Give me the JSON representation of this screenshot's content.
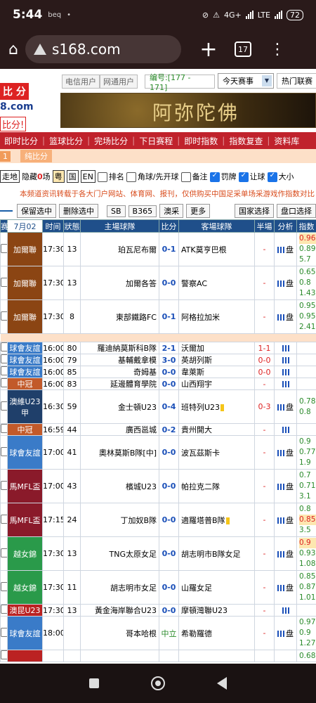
{
  "status": {
    "time": "5:44",
    "carrier_mark": "beq",
    "battery": "72",
    "net": "4G+",
    "lte": "LTE"
  },
  "browser": {
    "url": "s168.com",
    "tabs_count": "17"
  },
  "header": {
    "logo_top": "比 分",
    "logo_mid": "8.com",
    "logo_bot": "比分!",
    "telecom": "电信用户",
    "netcom": "网通用户",
    "account": "编号:[177 - 171]",
    "filter_select": "今天赛事",
    "hot_leagues": "热门联赛",
    "banner_text": "阿弥陀佛"
  },
  "nav": [
    "即时比分",
    "篮球比分",
    "完场比分",
    "下日赛程",
    "即时指数",
    "指数复查",
    "资料库"
  ],
  "subnav": {
    "tab1": "1",
    "tab2": "纯比分"
  },
  "options": {
    "walk": "走地",
    "hidden_prefix": "隐藏",
    "hidden_count": "0",
    "hidden_suffix": "场",
    "lang_yue": "粤",
    "lang_guo": "国",
    "lang_en": "EN",
    "rank": "排名",
    "corner": "角球/先开球",
    "note": "备注",
    "card": "罚牌",
    "handicap": "让球",
    "overunder": "大小"
  },
  "notice": "本频道资讯转载于各大门户网站、体育网、报刊，仅供购买中国足采单场采游戏作指数对比",
  "toolbar": {
    "keep": "保留选中",
    "delete": "删除选中",
    "sb": "SB",
    "b365": "B365",
    "macau": "澳采",
    "more": "更多",
    "country": "国家选择",
    "handicap_select": "盘口选择"
  },
  "table_headers": {
    "c0": "赛",
    "date": "7月02",
    "time": "时间",
    "state": "狀態",
    "home": "主場球隊",
    "score": "比分",
    "away": "客場球隊",
    "half": "半場",
    "analysis": "分析",
    "index": "指数"
  },
  "analysis_label": "盘",
  "rows": [
    {
      "league": "加爾聯",
      "color": "#8b4513",
      "time": "17:30",
      "state": "13",
      "home": "珀瓦尼布爾",
      "score": "0-1",
      "away": "ATK莫亨巴根",
      "half": "-",
      "idx": [
        "0.96",
        "0.89",
        "5.7"
      ],
      "hl": 0,
      "tall": true
    },
    {
      "league": "加爾聯",
      "color": "#8b4513",
      "time": "17:30",
      "state": "13",
      "home": "加爾各答",
      "score": "0-0",
      "away": "警察AC",
      "half": "-",
      "idx": [
        "0.65",
        "0.8",
        "1.43"
      ],
      "hl": -1,
      "tall": true
    },
    {
      "league": "加爾聯",
      "color": "#8b4513",
      "time": "17:30",
      "state": "8",
      "home": "東部鐵路FC",
      "score": "0-1",
      "away": "阿格拉加米",
      "half": "-",
      "idx": [
        "0.95",
        "0.95",
        "2.41"
      ],
      "hl": -2,
      "tall": true
    },
    {
      "league": "球會友誼",
      "color": "#3a7bc8",
      "time": "16:00",
      "state": "80",
      "home": "羅迪納莫斯科B隊",
      "score": "2-1",
      "away": "沃爾加",
      "half": "1-1",
      "idx": [],
      "hl": -1,
      "tall": false
    },
    {
      "league": "球會友誼",
      "color": "#3a7bc8",
      "time": "16:00",
      "state": "79",
      "home": "基輔戴拿模",
      "score": "3-0",
      "away": "英胡列斯",
      "half": "0-0",
      "idx": [],
      "hl": -1,
      "tall": false
    },
    {
      "league": "球會友誼",
      "color": "#3a7bc8",
      "time": "16:00",
      "state": "85",
      "home": "奇姆基",
      "score": "0-0",
      "away": "韋萊斯",
      "half": "0-0",
      "idx": [],
      "hl": -1,
      "tall": false
    },
    {
      "league": "中冠",
      "color": "#c25a2a",
      "time": "16:00",
      "state": "83",
      "home": "延邊體育學院",
      "score": "0-0",
      "away": "山西翔宇",
      "half": "-",
      "idx": [],
      "hl": -1,
      "tall": false
    },
    {
      "league": "澳維U23甲",
      "color": "#1f3f6a",
      "time": "16:30",
      "state": "59",
      "home": "金士頓U23",
      "score": "0-4",
      "away": "班特列U23",
      "half": "0-3",
      "idx": [
        "0.78",
        "0.8"
      ],
      "hl": -2,
      "tall": true
    },
    {
      "league": "中冠",
      "color": "#c25a2a",
      "time": "16:59",
      "state": "44",
      "home": "廣西邕城",
      "score": "0-2",
      "away": "貴州開大",
      "half": "-",
      "idx": [],
      "hl": -1,
      "tall": false
    },
    {
      "league": "球會友誼",
      "color": "#3a7bc8",
      "time": "17:00",
      "state": "41",
      "home": "奧林莫斯B隊[中]",
      "score": "0-0",
      "away": "波瓦茲斯卡",
      "half": "-",
      "idx": [
        "0.9",
        "0.77",
        "1.9"
      ],
      "hl": -1,
      "tall": true
    },
    {
      "league": "馬MFL盃",
      "color": "#8a1a2a",
      "time": "17:00",
      "state": "43",
      "home": "檳城U23",
      "score": "0-0",
      "away": "帕拉克二隊",
      "half": "-",
      "idx": [
        "0.7",
        "0.71",
        "3.1"
      ],
      "hl": -2,
      "tall": true
    },
    {
      "league": "馬MFL盃",
      "color": "#8a1a2a",
      "time": "17:15",
      "state": "24",
      "home": "丁加奴B隊",
      "score": "0-0",
      "away": "適羅塔普B隊",
      "half": "-",
      "idx": [
        "0.8",
        "0.85",
        "3.5"
      ],
      "hl": 1,
      "tall": true
    },
    {
      "league": "越女錦",
      "color": "#2a9a4a",
      "time": "17:30",
      "state": "13",
      "home": "TNG太原女足",
      "score": "0-0",
      "away": "胡志明市B隊女足",
      "half": "-",
      "idx": [
        "0.9",
        "0.93",
        "1.08"
      ],
      "hl": 0,
      "tall": true
    },
    {
      "league": "越女錦",
      "color": "#2a9a4a",
      "time": "17:30",
      "state": "11",
      "home": "胡志明市女足",
      "score": "0-0",
      "away": "山羅女足",
      "half": "-",
      "idx": [
        "0.85",
        "0.87",
        "1.01"
      ],
      "hl": -2,
      "tall": true
    },
    {
      "league": "澳昆U23",
      "color": "#b22",
      "time": "17:30",
      "state": "13",
      "home": "黃金海岸聯合U23",
      "score": "0-0",
      "away": "摩頓灣聯U23",
      "half": "-",
      "idx": [],
      "hl": -1,
      "tall": false
    },
    {
      "league": "球會友誼",
      "color": "#3a7bc8",
      "time": "18:00",
      "state": "",
      "home": "哥本哈根",
      "score": "中立",
      "away": "希勒羅德",
      "half": "-",
      "idx": [
        "0.97",
        "0.9",
        "1.27"
      ],
      "hl": -1,
      "tall": true,
      "neutral": true
    },
    {
      "league": "",
      "color": "#b22",
      "time": "",
      "state": "",
      "home": "",
      "score": "",
      "away": "",
      "half": "",
      "idx": [
        "0.68"
      ],
      "hl": -1,
      "tall": false
    }
  ]
}
